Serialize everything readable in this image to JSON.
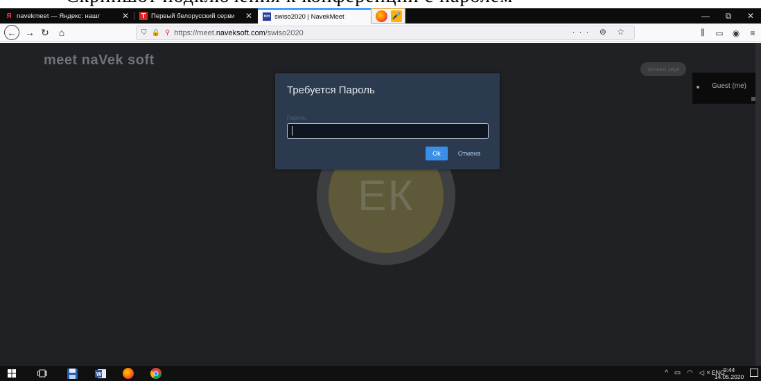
{
  "tabs": [
    {
      "label": "navekmeet — Яндекс: нашлос",
      "favicon": "Я",
      "favicon_color": "#ff3333"
    },
    {
      "label": "Первый белорусский сервис",
      "favicon": "T",
      "favicon_color": "#ffffff",
      "favicon_bg": "#d6281e"
    },
    {
      "label": "swiso2020 | NavekMeet",
      "favicon": "nm",
      "favicon_color": "#ffffff",
      "favicon_bg": "#2a3c9e",
      "active": true
    }
  ],
  "window_controls": {
    "minimize": "—",
    "restore": "⧉",
    "close": "✕"
  },
  "address": {
    "protocol": "https://meet.",
    "domain": "naveksoft.com",
    "path": "/swiso2020",
    "page_actions": "··· ⊚ ☆"
  },
  "toolbar_icons": {
    "library": "⫼",
    "reader": "▭",
    "account": "◉",
    "menu": "≡"
  },
  "app": {
    "brand": "meet naVek soft",
    "avatar_initials": "ЕК",
    "only_sound_label": "только звук",
    "self_name": "Guest (me)"
  },
  "dialog": {
    "title": "Требуется Пароль",
    "field_label": "Пароль",
    "field_value": "",
    "ok_label": "Ok",
    "cancel_label": "Отмена"
  },
  "taskbar": {
    "lang": "ENG",
    "time": "9:44",
    "date": "14.05.2020"
  },
  "colors": {
    "page_bg": "#1f2124",
    "dialog_bg": "#2b3a4f",
    "ok_button": "#3a8fe8",
    "active_tab_accent": "#0a84ff"
  }
}
